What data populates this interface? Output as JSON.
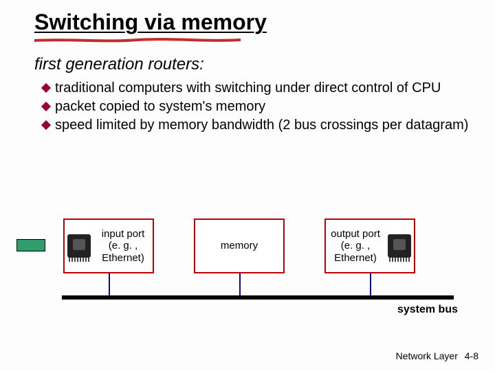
{
  "title": "Switching via memory",
  "subtitle": "first generation routers:",
  "bullets": [
    "traditional computers with switching under direct control of CPU",
    "packet copied to system's memory",
    " speed limited by memory bandwidth (2 bus crossings per datagram)"
  ],
  "diagram": {
    "input_label": "input port (e. g. , Ethernet)",
    "memory_label": "memory",
    "output_label": "output port (e. g. , Ethernet)",
    "bus_label": "system bus"
  },
  "footer": {
    "layer": "Network Layer",
    "page": "4-8"
  },
  "icons": {
    "bullet": "diamond-icon",
    "port": "ethernet-port-icon"
  },
  "colors": {
    "accent_underline": "#c52b2b",
    "box_border": "#c00000",
    "bus_drop": "#0a0a99",
    "bullet_diamond": "#990033",
    "green_rect": "#2e9e6f"
  }
}
